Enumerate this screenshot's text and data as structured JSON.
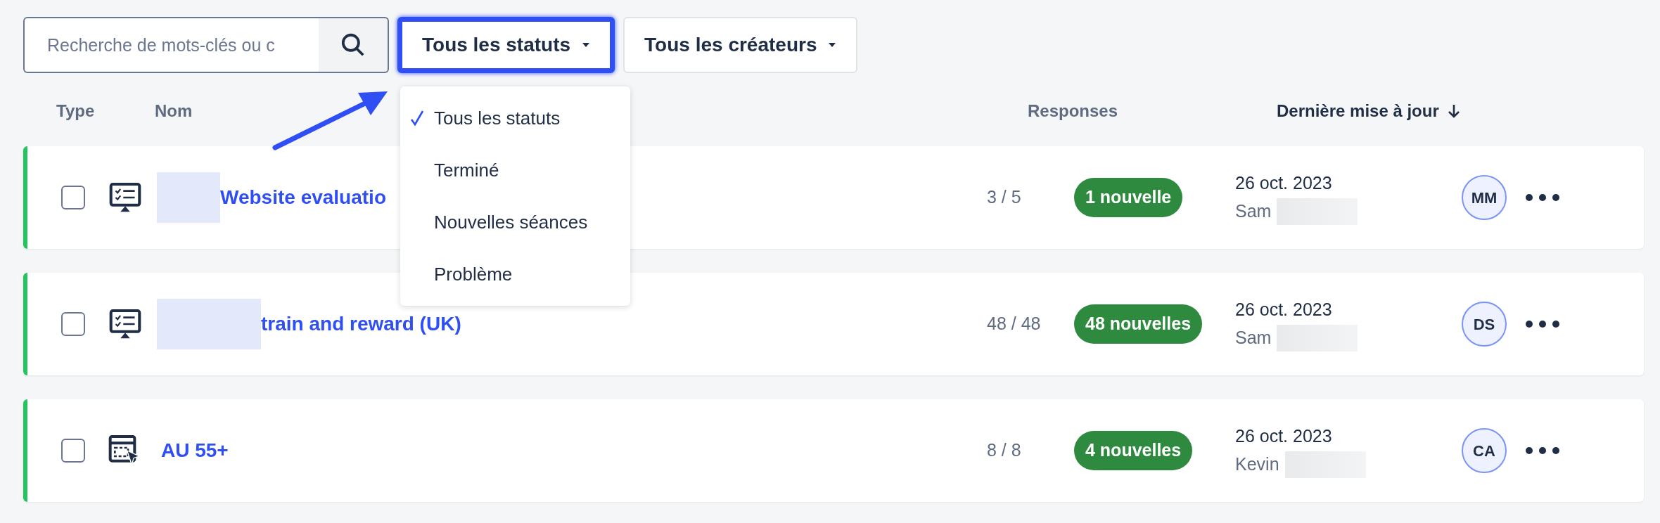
{
  "search": {
    "placeholder": "Recherche de mots-clés ou c"
  },
  "filters": [
    {
      "label": "Tous les statuts",
      "highlighted": true
    },
    {
      "label": "Tous les créateurs",
      "highlighted": false
    }
  ],
  "status_menu": [
    {
      "label": "Tous les statuts",
      "selected": true
    },
    {
      "label": "Terminé",
      "selected": false
    },
    {
      "label": "Nouvelles séances",
      "selected": false
    },
    {
      "label": "Problème",
      "selected": false
    }
  ],
  "columns": [
    {
      "label": "Type",
      "sorted": false
    },
    {
      "label": "Nom",
      "sorted": false
    },
    {
      "label": "Responses",
      "sorted": false
    },
    {
      "label": "Dernière mise à jour",
      "sorted": true
    }
  ],
  "rows": [
    {
      "kind": "survey",
      "checked": false,
      "name_redacted": true,
      "name": "Website evaluatio",
      "responses": "3 / 5",
      "badge": "1 nouvelle",
      "date": "26 oct. 2023",
      "author": "Sam",
      "author_redacted": true,
      "initials": "MM"
    },
    {
      "kind": "survey",
      "checked": false,
      "name_redacted": true,
      "name": "train and reward (UK)",
      "responses": "48 / 48",
      "badge": "48 nouvelles",
      "date": "26 oct. 2023",
      "author": "Sam",
      "author_redacted": true,
      "initials": "DS"
    },
    {
      "kind": "click",
      "checked": false,
      "name_redacted": false,
      "name": "AU 55+",
      "responses": "8 / 8",
      "badge": "4 nouvelles",
      "date": "26 oct. 2023",
      "author": "Kevin",
      "author_redacted": true,
      "initials": "CA"
    }
  ]
}
